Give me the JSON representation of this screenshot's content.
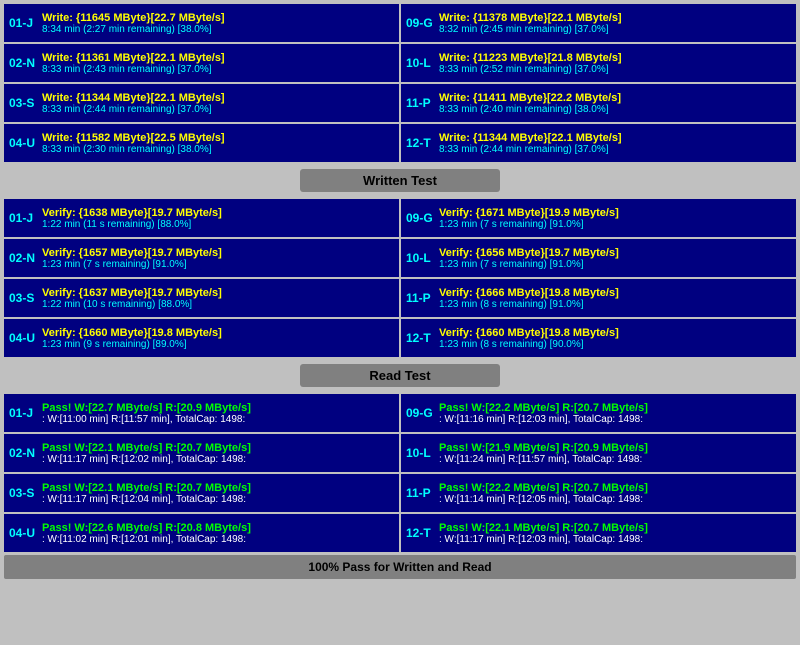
{
  "sections": {
    "write": {
      "rows": [
        {
          "left": {
            "id": "01-J",
            "line1": "Write: {11645 MByte}[22.7 MByte/s]",
            "line2": "8:34 min (2:27 min remaining)  [38.0%]"
          },
          "right": {
            "id": "09-G",
            "line1": "Write: {11378 MByte}[22.1 MByte/s]",
            "line2": "8:32 min (2:45 min remaining)  [37.0%]"
          }
        },
        {
          "left": {
            "id": "02-N",
            "line1": "Write: {11361 MByte}[22.1 MByte/s]",
            "line2": "8:33 min (2:43 min remaining)  [37.0%]"
          },
          "right": {
            "id": "10-L",
            "line1": "Write: {11223 MByte}[21.8 MByte/s]",
            "line2": "8:33 min (2:52 min remaining)  [37.0%]"
          }
        },
        {
          "left": {
            "id": "03-S",
            "line1": "Write: {11344 MByte}[22.1 MByte/s]",
            "line2": "8:33 min (2:44 min remaining)  [37.0%]"
          },
          "right": {
            "id": "11-P",
            "line1": "Write: {11411 MByte}[22.2 MByte/s]",
            "line2": "8:33 min (2:40 min remaining)  [38.0%]"
          }
        },
        {
          "left": {
            "id": "04-U",
            "line1": "Write: {11582 MByte}[22.5 MByte/s]",
            "line2": "8:33 min (2:30 min remaining)  [38.0%]"
          },
          "right": {
            "id": "12-T",
            "line1": "Write: {11344 MByte}[22.1 MByte/s]",
            "line2": "8:33 min (2:44 min remaining)  [37.0%]"
          }
        }
      ],
      "header": "Written Test"
    },
    "verify": {
      "rows": [
        {
          "left": {
            "id": "01-J",
            "line1": "Verify: {1638 MByte}[19.7 MByte/s]",
            "line2": "1:22 min (11 s remaining)   [88.0%]"
          },
          "right": {
            "id": "09-G",
            "line1": "Verify: {1671 MByte}[19.9 MByte/s]",
            "line2": "1:23 min (7 s remaining)   [91.0%]"
          }
        },
        {
          "left": {
            "id": "02-N",
            "line1": "Verify: {1657 MByte}[19.7 MByte/s]",
            "line2": "1:23 min (7 s remaining)   [91.0%]"
          },
          "right": {
            "id": "10-L",
            "line1": "Verify: {1656 MByte}[19.7 MByte/s]",
            "line2": "1:23 min (7 s remaining)   [91.0%]"
          }
        },
        {
          "left": {
            "id": "03-S",
            "line1": "Verify: {1637 MByte}[19.7 MByte/s]",
            "line2": "1:22 min (10 s remaining)   [88.0%]"
          },
          "right": {
            "id": "11-P",
            "line1": "Verify: {1666 MByte}[19.8 MByte/s]",
            "line2": "1:23 min (8 s remaining)   [91.0%]"
          }
        },
        {
          "left": {
            "id": "04-U",
            "line1": "Verify: {1660 MByte}[19.8 MByte/s]",
            "line2": "1:23 min (9 s remaining)   [89.0%]"
          },
          "right": {
            "id": "12-T",
            "line1": "Verify: {1660 MByte}[19.8 MByte/s]",
            "line2": "1:23 min (8 s remaining)   [90.0%]"
          }
        }
      ],
      "header": "Read Test"
    },
    "pass": {
      "rows": [
        {
          "left": {
            "id": "01-J",
            "line1": "Pass! W:[22.7 MByte/s] R:[20.9 MByte/s]",
            "line2": ": W:[11:00 min] R:[11:57 min], TotalCap: 1498:"
          },
          "right": {
            "id": "09-G",
            "line1": "Pass! W:[22.2 MByte/s] R:[20.7 MByte/s]",
            "line2": ": W:[11:16 min] R:[12:03 min], TotalCap: 1498:"
          }
        },
        {
          "left": {
            "id": "02-N",
            "line1": "Pass! W:[22.1 MByte/s] R:[20.7 MByte/s]",
            "line2": ": W:[11:17 min] R:[12:02 min], TotalCap: 1498:"
          },
          "right": {
            "id": "10-L",
            "line1": "Pass! W:[21.9 MByte/s] R:[20.9 MByte/s]",
            "line2": ": W:[11:24 min] R:[11:57 min], TotalCap: 1498:"
          }
        },
        {
          "left": {
            "id": "03-S",
            "line1": "Pass! W:[22.1 MByte/s] R:[20.7 MByte/s]",
            "line2": ": W:[11:17 min] R:[12:04 min], TotalCap: 1498:"
          },
          "right": {
            "id": "11-P",
            "line1": "Pass! W:[22.2 MByte/s] R:[20.7 MByte/s]",
            "line2": ": W:[11:14 min] R:[12:05 min], TotalCap: 1498:"
          }
        },
        {
          "left": {
            "id": "04-U",
            "line1": "Pass! W:[22.6 MByte/s] R:[20.8 MByte/s]",
            "line2": ": W:[11:02 min] R:[12:01 min], TotalCap: 1498:"
          },
          "right": {
            "id": "12-T",
            "line1": "Pass! W:[22.1 MByte/s] R:[20.7 MByte/s]",
            "line2": ": W:[11:17 min] R:[12:03 min], TotalCap: 1498:"
          }
        }
      ]
    }
  },
  "footer": "100% Pass for Written and Read"
}
